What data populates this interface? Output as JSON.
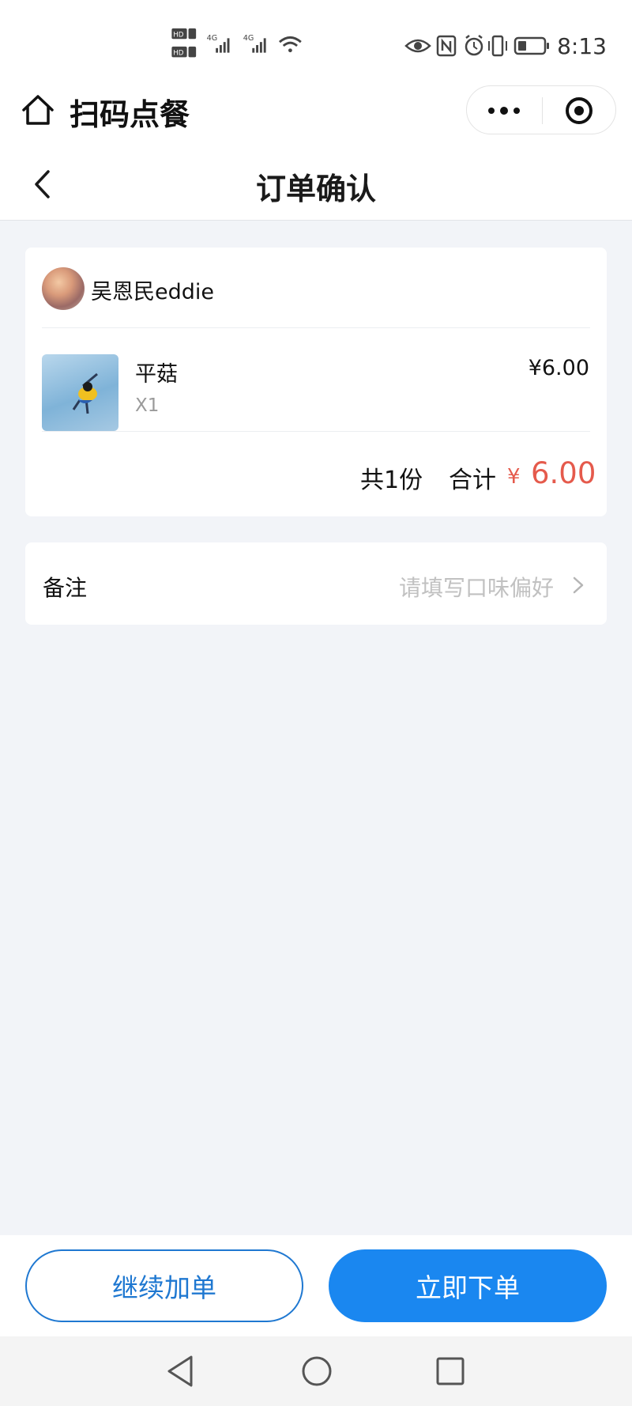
{
  "status_bar": {
    "time": "8:13",
    "left_icons": [
      "hd-1-icon",
      "hd-2-icon",
      "4g-signal-icon",
      "4g-signal-icon",
      "wifi-icon"
    ],
    "right_icons": [
      "eye-icon",
      "nfc-icon",
      "alarm-icon",
      "vibrate-icon",
      "battery-icon"
    ]
  },
  "mini_program": {
    "title": "扫码点餐",
    "home_icon": "home-icon",
    "more_icon": "more-dots-icon",
    "close_icon": "target-close-icon"
  },
  "nav": {
    "title": "订单确认",
    "back_icon": "chevron-left-icon"
  },
  "order": {
    "user_name": "吴恩民eddie",
    "items": [
      {
        "name": "平菇",
        "qty": "X1",
        "price": "¥6.00"
      }
    ],
    "count_text": "共1份",
    "total_label": "合计",
    "currency": "¥",
    "total_value": "6.00"
  },
  "remark": {
    "label": "备注",
    "placeholder": "请填写口味偏好",
    "arrow_icon": "chevron-right-icon"
  },
  "actions": {
    "continue_label": "继续加单",
    "order_label": "立即下单"
  },
  "colors": {
    "accent": "#1a87f0",
    "price_red": "#e55a4c",
    "background": "#f2f4f8"
  },
  "system_nav": [
    "back-triangle-icon",
    "home-circle-icon",
    "recents-square-icon"
  ]
}
